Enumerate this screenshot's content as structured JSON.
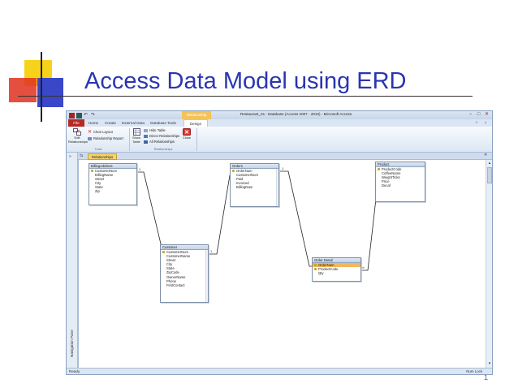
{
  "slide": {
    "title": "Access Data Model using ERD",
    "number": "1"
  },
  "window": {
    "title": "Restaurant_01 : Database (Access 2007 - 2010) - Microsoft Access",
    "context_tab": "Relationship Tools",
    "controls": [
      "−",
      "□",
      "✕"
    ]
  },
  "ribbon": {
    "tabs": [
      {
        "label": "File"
      },
      {
        "label": "Home"
      },
      {
        "label": "Create"
      },
      {
        "label": "External Data"
      },
      {
        "label": "Database Tools"
      },
      {
        "label": "Design"
      }
    ],
    "tools": {
      "edit_relationships": "Edit Relationships",
      "clear_layout": "Clear Layout",
      "relationship_report": "Relationship Report",
      "group_label": "Tools"
    },
    "relationships": {
      "show_table": "Show Table",
      "hide_table": "Hide Table",
      "direct_relationships": "Direct Relationships",
      "all_relationships": "All Relationships",
      "close": "Close",
      "group_label": "Relationships"
    }
  },
  "nav_pane": {
    "label": "Navigation Pane"
  },
  "document_tab": {
    "label": "Relationships"
  },
  "status": {
    "left": "Ready",
    "right": "Num Lock"
  },
  "tables": {
    "billing_address": {
      "name": "BillingAddress",
      "fields": [
        {
          "name": "CustomerNum",
          "key": true
        },
        {
          "name": "BillingName",
          "key": false
        },
        {
          "name": "Street",
          "key": false
        },
        {
          "name": "City",
          "key": false
        },
        {
          "name": "State",
          "key": false
        },
        {
          "name": "Zip",
          "key": false
        }
      ]
    },
    "orders": {
      "name": "Orders",
      "fields": [
        {
          "name": "OrderNum",
          "key": true
        },
        {
          "name": "CustomerNum",
          "key": false
        },
        {
          "name": "Paid",
          "key": false
        },
        {
          "name": "Invoiced",
          "key": false
        },
        {
          "name": "BillingDate",
          "key": false
        }
      ]
    },
    "product": {
      "name": "Product",
      "fields": [
        {
          "name": "ProductCode",
          "key": true
        },
        {
          "name": "CoffeeName",
          "key": false
        },
        {
          "name": "WeightTicks",
          "key": false
        },
        {
          "name": "Price",
          "key": false
        },
        {
          "name": "Decaf",
          "key": false
        }
      ]
    },
    "customer": {
      "name": "Customer",
      "fields": [
        {
          "name": "CustomerNum",
          "key": true
        },
        {
          "name": "CustomerName",
          "key": false
        },
        {
          "name": "Street",
          "key": false
        },
        {
          "name": "City",
          "key": false
        },
        {
          "name": "State",
          "key": false
        },
        {
          "name": "ZipCode",
          "key": false
        },
        {
          "name": "OwnerName",
          "key": false
        },
        {
          "name": "Phone",
          "key": false
        },
        {
          "name": "FirstContact",
          "key": false
        }
      ]
    },
    "order_detail": {
      "name": "Order Detail",
      "fields": [
        {
          "name": "OrderNum",
          "key": true,
          "selected": true
        },
        {
          "name": "ProductCode",
          "key": true
        },
        {
          "name": "Qty",
          "key": false
        }
      ]
    }
  },
  "relationships": [
    {
      "from": "BillingAddress.CustomerNum",
      "to": "Customer.CustomerNum",
      "from_end": "1",
      "to_end": "1"
    },
    {
      "from": "Customer.CustomerNum",
      "to": "Orders.CustomerNum",
      "from_end": "1",
      "to_end": "∞"
    },
    {
      "from": "Orders.OrderNum",
      "to": "Order Detail.OrderNum",
      "from_end": "1",
      "to_end": "∞"
    },
    {
      "from": "Product.ProductCode",
      "to": "Order Detail.ProductCode",
      "from_end": "1",
      "to_end": "∞"
    }
  ],
  "colors": {
    "title": "#2a35b0",
    "file_tab": "#b52a25",
    "selected_field": "#f3b85a",
    "document_tab": "#f6d36e"
  }
}
